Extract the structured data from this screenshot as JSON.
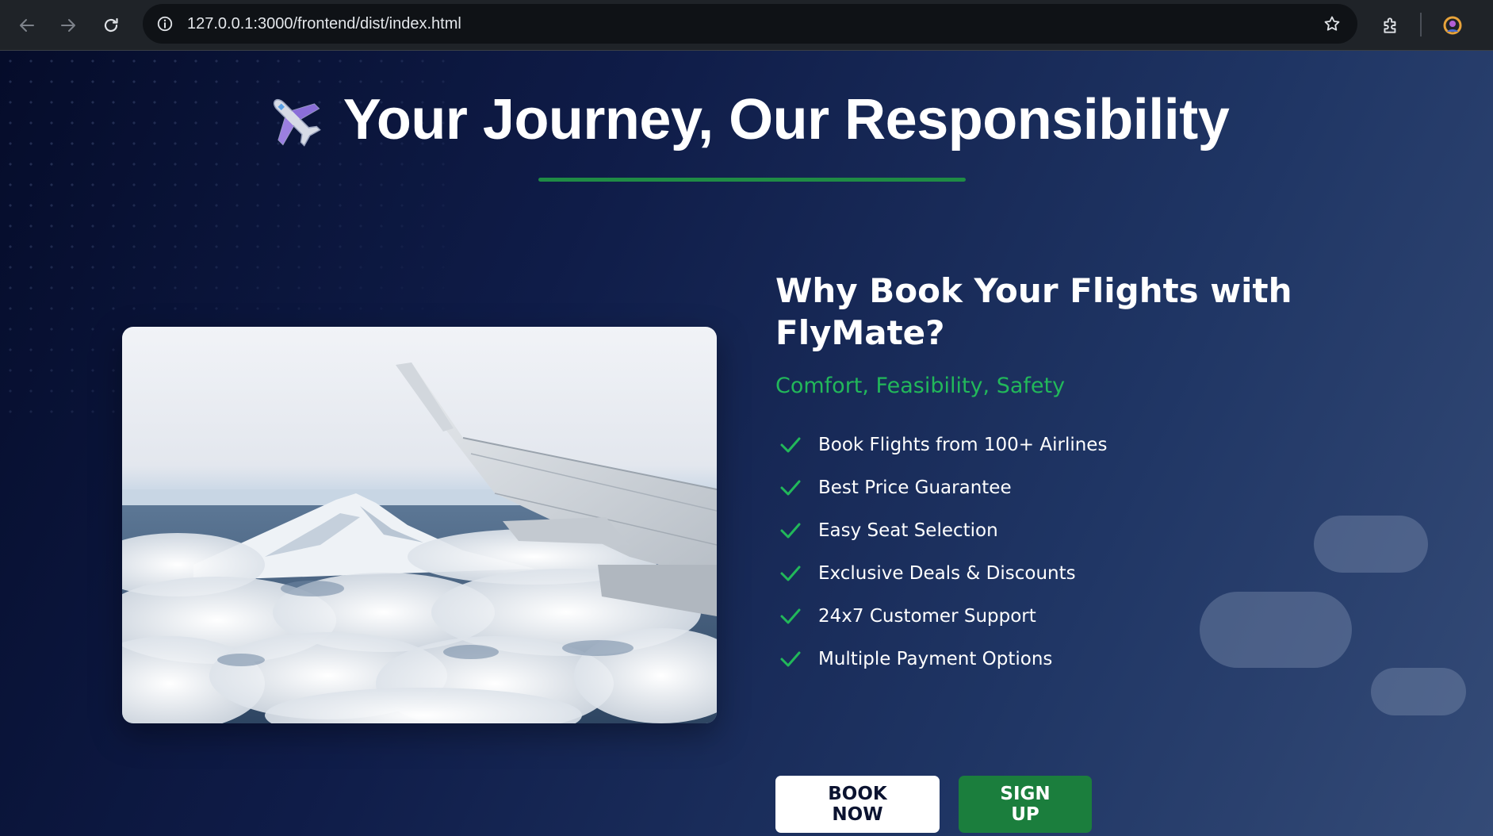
{
  "browser": {
    "url": "127.0.0.1:3000/frontend/dist/index.html"
  },
  "hero": {
    "title": "Your Journey, Our Responsibility",
    "accent_color": "#1f8c45"
  },
  "info": {
    "heading": "Why Book Your Flights with FlyMate?",
    "tagline": "Comfort, Feasibility, Safety",
    "features": [
      "Book Flights from 100+ Airlines",
      "Best Price Guarantee",
      "Easy Seat Selection",
      "Exclusive Deals & Discounts",
      "24x7 Customer Support",
      "Multiple Payment Options"
    ]
  },
  "actions": {
    "book_label": "BOOK NOW",
    "signup_label": "SIGN UP"
  },
  "colors": {
    "tagline_green": "#22b85a",
    "signup_green": "#1b7e3d",
    "background_dark": "#050c2a",
    "background_light": "#344b77"
  }
}
